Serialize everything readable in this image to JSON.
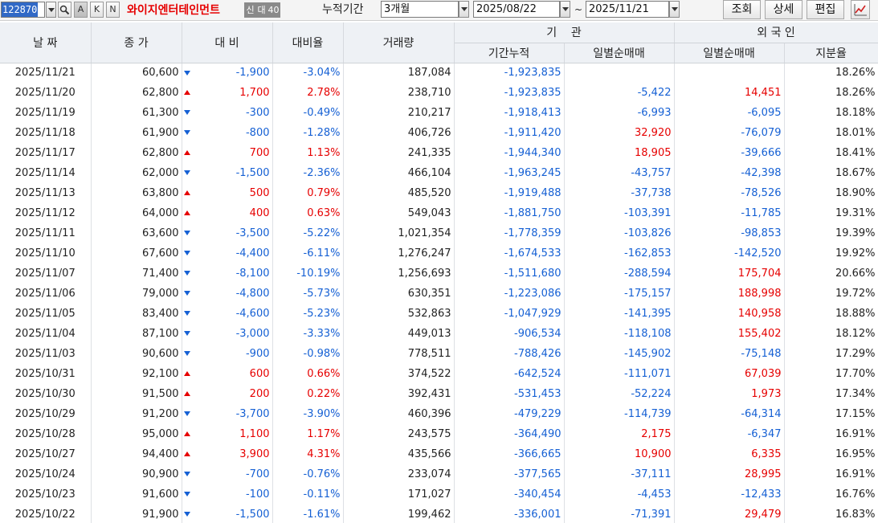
{
  "toolbar": {
    "code": "122870",
    "mode_buttons": [
      "A",
      "K",
      "N"
    ],
    "stock_name": "와이지엔터테인먼트",
    "tag_credit": "신",
    "tag_loan": "대",
    "tag_number": "40",
    "period_label": "누적기간",
    "period_value": "3개월",
    "start_date": "2025/08/22",
    "range_sep": "~",
    "end_date": "2025/11/21",
    "query_label": "조회",
    "detail_label": "상세",
    "edit_label": "편집",
    "chart_icon": "line-chart-icon"
  },
  "headers": {
    "date": "날 짜",
    "close": "종 가",
    "change": "대 비",
    "change_rate": "대비율",
    "volume": "거래량",
    "institution": "기    관",
    "inst_cumulative": "기간누적",
    "inst_daily": "일별순매매",
    "foreign": "외 국 인",
    "frgn_daily": "일별순매매",
    "frgn_ratio": "지분율"
  },
  "colors": {
    "up": "#e60000",
    "down": "#1560d4",
    "header_bg": "#eef1f5"
  },
  "rows": [
    {
      "date": "2025/11/21",
      "close": "60,600",
      "dir": "down",
      "change": "-1,900",
      "rate": "-3.04%",
      "volume": "187,084",
      "inst_cum": "-1,923,835",
      "inst_daily": "",
      "frgn_daily": "",
      "ratio": "18.26%"
    },
    {
      "date": "2025/11/20",
      "close": "62,800",
      "dir": "up",
      "change": "1,700",
      "rate": "2.78%",
      "volume": "238,710",
      "inst_cum": "-1,923,835",
      "inst_daily": "-5,422",
      "frgn_daily": "14,451",
      "ratio": "18.26%"
    },
    {
      "date": "2025/11/19",
      "close": "61,300",
      "dir": "down",
      "change": "-300",
      "rate": "-0.49%",
      "volume": "210,217",
      "inst_cum": "-1,918,413",
      "inst_daily": "-6,993",
      "frgn_daily": "-6,095",
      "ratio": "18.18%"
    },
    {
      "date": "2025/11/18",
      "close": "61,900",
      "dir": "down",
      "change": "-800",
      "rate": "-1.28%",
      "volume": "406,726",
      "inst_cum": "-1,911,420",
      "inst_daily": "32,920",
      "frgn_daily": "-76,079",
      "ratio": "18.01%"
    },
    {
      "date": "2025/11/17",
      "close": "62,800",
      "dir": "up",
      "change": "700",
      "rate": "1.13%",
      "volume": "241,335",
      "inst_cum": "-1,944,340",
      "inst_daily": "18,905",
      "frgn_daily": "-39,666",
      "ratio": "18.41%"
    },
    {
      "date": "2025/11/14",
      "close": "62,000",
      "dir": "down",
      "change": "-1,500",
      "rate": "-2.36%",
      "volume": "466,104",
      "inst_cum": "-1,963,245",
      "inst_daily": "-43,757",
      "frgn_daily": "-42,398",
      "ratio": "18.67%"
    },
    {
      "date": "2025/11/13",
      "close": "63,800",
      "dir": "up",
      "change": "500",
      "rate": "0.79%",
      "volume": "485,520",
      "inst_cum": "-1,919,488",
      "inst_daily": "-37,738",
      "frgn_daily": "-78,526",
      "ratio": "18.90%"
    },
    {
      "date": "2025/11/12",
      "close": "64,000",
      "dir": "up",
      "change": "400",
      "rate": "0.63%",
      "volume": "549,043",
      "inst_cum": "-1,881,750",
      "inst_daily": "-103,391",
      "frgn_daily": "-11,785",
      "ratio": "19.31%"
    },
    {
      "date": "2025/11/11",
      "close": "63,600",
      "dir": "down",
      "change": "-3,500",
      "rate": "-5.22%",
      "volume": "1,021,354",
      "inst_cum": "-1,778,359",
      "inst_daily": "-103,826",
      "frgn_daily": "-98,853",
      "ratio": "19.39%"
    },
    {
      "date": "2025/11/10",
      "close": "67,600",
      "dir": "down",
      "change": "-4,400",
      "rate": "-6.11%",
      "volume": "1,276,247",
      "inst_cum": "-1,674,533",
      "inst_daily": "-162,853",
      "frgn_daily": "-142,520",
      "ratio": "19.92%"
    },
    {
      "date": "2025/11/07",
      "close": "71,400",
      "dir": "down",
      "change": "-8,100",
      "rate": "-10.19%",
      "volume": "1,256,693",
      "inst_cum": "-1,511,680",
      "inst_daily": "-288,594",
      "frgn_daily": "175,704",
      "ratio": "20.66%"
    },
    {
      "date": "2025/11/06",
      "close": "79,000",
      "dir": "down",
      "change": "-4,800",
      "rate": "-5.73%",
      "volume": "630,351",
      "inst_cum": "-1,223,086",
      "inst_daily": "-175,157",
      "frgn_daily": "188,998",
      "ratio": "19.72%"
    },
    {
      "date": "2025/11/05",
      "close": "83,400",
      "dir": "down",
      "change": "-4,600",
      "rate": "-5.23%",
      "volume": "532,863",
      "inst_cum": "-1,047,929",
      "inst_daily": "-141,395",
      "frgn_daily": "140,958",
      "ratio": "18.88%"
    },
    {
      "date": "2025/11/04",
      "close": "87,100",
      "dir": "down",
      "change": "-3,000",
      "rate": "-3.33%",
      "volume": "449,013",
      "inst_cum": "-906,534",
      "inst_daily": "-118,108",
      "frgn_daily": "155,402",
      "ratio": "18.12%"
    },
    {
      "date": "2025/11/03",
      "close": "90,600",
      "dir": "down",
      "change": "-900",
      "rate": "-0.98%",
      "volume": "778,511",
      "inst_cum": "-788,426",
      "inst_daily": "-145,902",
      "frgn_daily": "-75,148",
      "ratio": "17.29%"
    },
    {
      "date": "2025/10/31",
      "close": "92,100",
      "dir": "up",
      "change": "600",
      "rate": "0.66%",
      "volume": "374,522",
      "inst_cum": "-642,524",
      "inst_daily": "-111,071",
      "frgn_daily": "67,039",
      "ratio": "17.70%"
    },
    {
      "date": "2025/10/30",
      "close": "91,500",
      "dir": "up",
      "change": "200",
      "rate": "0.22%",
      "volume": "392,431",
      "inst_cum": "-531,453",
      "inst_daily": "-52,224",
      "frgn_daily": "1,973",
      "ratio": "17.34%"
    },
    {
      "date": "2025/10/29",
      "close": "91,200",
      "dir": "down",
      "change": "-3,700",
      "rate": "-3.90%",
      "volume": "460,396",
      "inst_cum": "-479,229",
      "inst_daily": "-114,739",
      "frgn_daily": "-64,314",
      "ratio": "17.15%"
    },
    {
      "date": "2025/10/28",
      "close": "95,000",
      "dir": "up",
      "change": "1,100",
      "rate": "1.17%",
      "volume": "243,575",
      "inst_cum": "-364,490",
      "inst_daily": "2,175",
      "frgn_daily": "-6,347",
      "ratio": "16.91%"
    },
    {
      "date": "2025/10/27",
      "close": "94,400",
      "dir": "up",
      "change": "3,900",
      "rate": "4.31%",
      "volume": "435,566",
      "inst_cum": "-366,665",
      "inst_daily": "10,900",
      "frgn_daily": "6,335",
      "ratio": "16.95%"
    },
    {
      "date": "2025/10/24",
      "close": "90,900",
      "dir": "down",
      "change": "-700",
      "rate": "-0.76%",
      "volume": "233,074",
      "inst_cum": "-377,565",
      "inst_daily": "-37,111",
      "frgn_daily": "28,995",
      "ratio": "16.91%"
    },
    {
      "date": "2025/10/23",
      "close": "91,600",
      "dir": "down",
      "change": "-100",
      "rate": "-0.11%",
      "volume": "171,027",
      "inst_cum": "-340,454",
      "inst_daily": "-4,453",
      "frgn_daily": "-12,433",
      "ratio": "16.76%"
    },
    {
      "date": "2025/10/22",
      "close": "91,900",
      "dir": "down",
      "change": "-1,500",
      "rate": "-1.61%",
      "volume": "199,462",
      "inst_cum": "-336,001",
      "inst_daily": "-71,391",
      "frgn_daily": "29,479",
      "ratio": "16.83%"
    }
  ]
}
